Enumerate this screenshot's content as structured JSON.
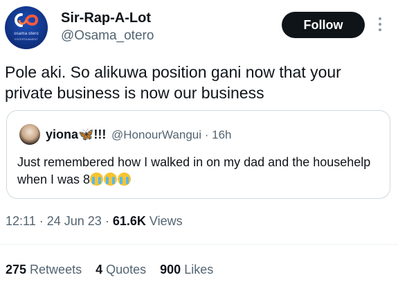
{
  "author": {
    "display_name": "Sir-Rap-A-Lot",
    "handle": "@Osama_otero",
    "avatar": {
      "brand": "osama otero",
      "tagline": "ENTERTAINMENT"
    }
  },
  "follow_label": "Follow",
  "tweet_text": "Pole aki. So alikuwa position gani now that your private business is now our business",
  "quoted": {
    "name": "yiona🦋!!!",
    "handle": "@HonourWangui",
    "time": "· 16h",
    "text": "Just remembered how I walked in on my dad and the househelp when I was 8"
  },
  "meta": {
    "time": "12:11",
    "date": "24 Jun 23",
    "views_count": "61.6K",
    "views_label": "Views"
  },
  "stats": {
    "retweets_count": "275",
    "retweets_label": "Retweets",
    "quotes_count": "4",
    "quotes_label": "Quotes",
    "likes_count": "900",
    "likes_label": "Likes"
  },
  "colors": {
    "text_primary": "#0f1419",
    "text_secondary": "#536471",
    "follow_bg": "#0f1419",
    "border": "#cfd9de"
  }
}
